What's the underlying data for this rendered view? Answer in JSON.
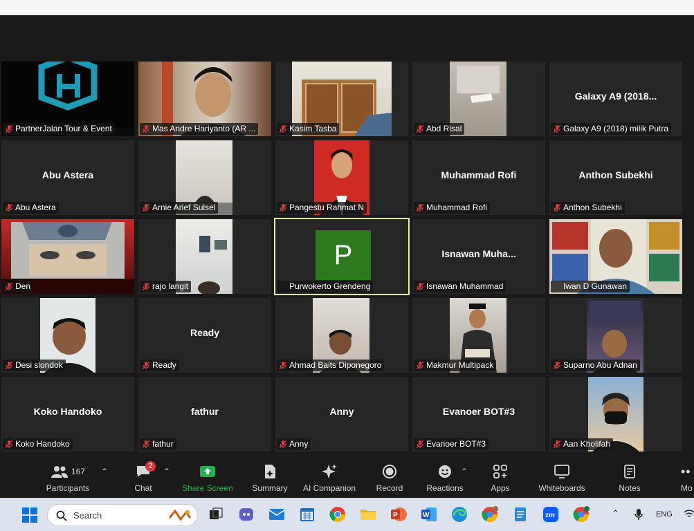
{
  "tiles": [
    {
      "name": "PartnerJalan Tour & Event",
      "big": "",
      "muted": true
    },
    {
      "name": "Mas Andre Hariyanto (AR ...",
      "big": "",
      "muted": true
    },
    {
      "name": "Kasim Tasba",
      "big": "",
      "muted": true
    },
    {
      "name": "Abd Risal",
      "big": "",
      "muted": true
    },
    {
      "name": "Galaxy A9 (2018) milik Putra",
      "big": "Galaxy A9 (2018...",
      "muted": true
    },
    {
      "name": "Abu Astera",
      "big": "Abu Astera",
      "muted": true
    },
    {
      "name": "Arnie Arief Sulsel",
      "big": "",
      "muted": true
    },
    {
      "name": "Pangestu Rahmat N",
      "big": "",
      "muted": true
    },
    {
      "name": "Muhammad Rofi",
      "big": "Muhammad Rofi",
      "muted": true
    },
    {
      "name": "Anthon Subekhi",
      "big": "Anthon Subekhi",
      "muted": true
    },
    {
      "name": "Den",
      "big": "",
      "muted": true
    },
    {
      "name": "rajo langit",
      "big": "",
      "muted": true
    },
    {
      "name": "Purwokerto Grendeng",
      "big": "",
      "muted": false,
      "avatar_letter": "P"
    },
    {
      "name": "Isnawan Muhammad",
      "big": "Isnawan  Muha...",
      "muted": true
    },
    {
      "name": "Iwan D Gunawan",
      "big": "",
      "muted": false
    },
    {
      "name": "Desi slondok",
      "big": "",
      "muted": true
    },
    {
      "name": "Ready",
      "big": "Ready",
      "muted": true
    },
    {
      "name": "Ahmad Baits Diponegoro",
      "big": "",
      "muted": true
    },
    {
      "name": "Makmur Multipack",
      "big": "",
      "muted": true
    },
    {
      "name": "Suparno Abu Adnan",
      "big": "",
      "muted": true
    },
    {
      "name": "Koko Handoko",
      "big": "Koko Handoko",
      "muted": true
    },
    {
      "name": "fathur",
      "big": "fathur",
      "muted": true
    },
    {
      "name": "Anny",
      "big": "Anny",
      "muted": true
    },
    {
      "name": "Evanoer BOT#3",
      "big": "Evanoer BOT#3",
      "muted": true
    },
    {
      "name": "Aan Kholifah",
      "big": "",
      "muted": true
    }
  ],
  "toolbar": {
    "participants_label": "Participants",
    "participants_count": "167",
    "chat_label": "Chat",
    "chat_badge": "2",
    "share_label": "Share Screen",
    "summary_label": "Summary",
    "ai_label": "AI Companion",
    "record_label": "Record",
    "reactions_label": "Reactions",
    "apps_label": "Apps",
    "whiteboards_label": "Whiteboards",
    "notes_label": "Notes",
    "more_label": "Mo"
  },
  "taskbar": {
    "search_placeholder": "Search",
    "lang": "ENG"
  },
  "colors": {
    "share_green": "#22b14c",
    "mic_red": "#e0373f",
    "active_border": "#e6ec9a",
    "avatar_green": "#2d7a1e"
  }
}
